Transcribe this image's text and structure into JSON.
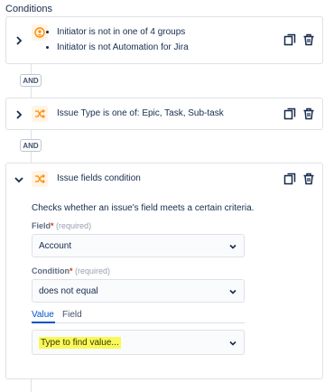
{
  "heading": "Conditions",
  "conditions": [
    {
      "lines": [
        "Initiator is not in one of 4 groups",
        "Initiator is not Automation for Jira"
      ]
    },
    {
      "text": "Issue Type is one of: Epic, Task, Sub-task"
    },
    {
      "title": "Issue fields condition",
      "description": "Checks whether an issue's field meets a certain criteria.",
      "field_label": "Field",
      "field_required": "*",
      "field_optional": "(required)",
      "field_value": "Account",
      "condition_label": "Condition",
      "condition_required": "*",
      "condition_optional": "(required)",
      "condition_value": "does not equal",
      "tabs": [
        "Value",
        "Field"
      ],
      "value_placeholder": "Type to find value..."
    }
  ],
  "and_label": "AND",
  "colors": {
    "accent": "#0052cc",
    "icon_bg": "#fff4e5",
    "icon_fg": "#ff8b00",
    "highlight": "#f8f85a"
  },
  "icons": [
    "chevron-right-icon",
    "person-icon",
    "shuffle-icon",
    "copy-icon",
    "trash-icon",
    "chevron-down-icon"
  ]
}
